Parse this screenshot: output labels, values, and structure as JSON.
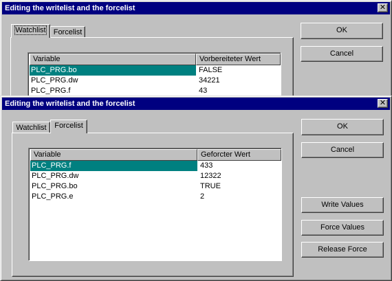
{
  "dialog1": {
    "title": "Editing the writelist and the forcelist",
    "tabs": [
      {
        "label": "Watchlist"
      },
      {
        "label": "Forcelist"
      }
    ],
    "active_tab": "Watchlist",
    "buttons": {
      "ok": "OK",
      "cancel": "Cancel"
    },
    "table": {
      "headers": [
        "Variable",
        "Vorbereiteter Wert"
      ],
      "rows": [
        {
          "variable": "PLC_PRG.bo",
          "value": "FALSE"
        },
        {
          "variable": "PLC_PRG.dw",
          "value": "34221"
        },
        {
          "variable": "PLC_PRG.f",
          "value": "43"
        }
      ]
    }
  },
  "dialog2": {
    "title": "Editing the writelist and the forcelist",
    "tabs": [
      {
        "label": "Watchlist"
      },
      {
        "label": "Forcelist"
      }
    ],
    "active_tab": "Forcelist",
    "buttons": {
      "ok": "OK",
      "cancel": "Cancel",
      "write_values": "Write Values",
      "force_values": "Force Values",
      "release_force": "Release Force"
    },
    "table": {
      "headers": [
        "Variable",
        "Geforcter Wert"
      ],
      "rows": [
        {
          "variable": "PLC_PRG.f",
          "value": "433"
        },
        {
          "variable": "PLC_PRG.dw",
          "value": "12322"
        },
        {
          "variable": "PLC_PRG.bo",
          "value": "TRUE"
        },
        {
          "variable": "PLC_PRG.e",
          "value": "2"
        }
      ]
    }
  },
  "colors": {
    "titlebar": "#000080",
    "selection": "#008080",
    "face": "#c0c0c0"
  }
}
